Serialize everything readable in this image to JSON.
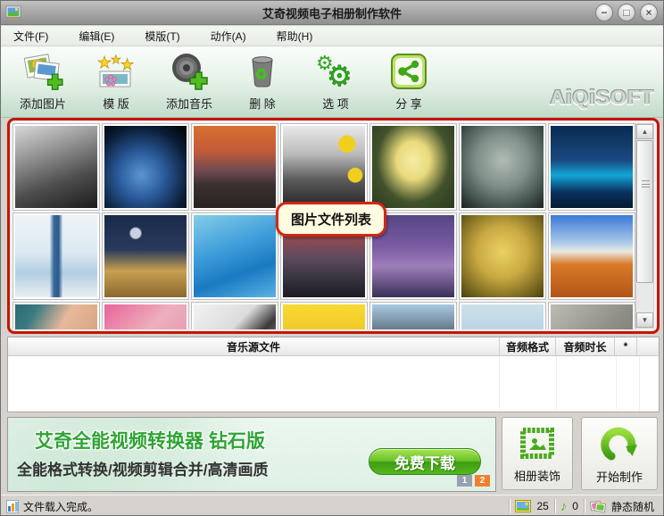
{
  "window": {
    "title": "艾奇视频电子相册制作软件",
    "controls": {
      "minimize": "−",
      "maximize": "□",
      "close": "×"
    }
  },
  "menu": {
    "items": [
      {
        "label": "文件(F)"
      },
      {
        "label": "编辑(E)"
      },
      {
        "label": "模版(T)"
      },
      {
        "label": "动作(A)"
      },
      {
        "label": "帮助(H)"
      }
    ]
  },
  "toolbar": {
    "buttons": [
      {
        "id": "add-images",
        "label": "添加图片"
      },
      {
        "id": "template",
        "label": "模 版"
      },
      {
        "id": "add-music",
        "label": "添加音乐"
      },
      {
        "id": "delete",
        "label": "删 除"
      },
      {
        "id": "options",
        "label": "选 项"
      },
      {
        "id": "share",
        "label": "分 享"
      }
    ],
    "logo": "AiQiSOFT"
  },
  "image_list": {
    "tooltip": "图片文件列表",
    "thumbnails": [
      {
        "name": "eiffel-tower-bw",
        "bg": "linear-gradient(160deg,#d8d8d8 0%,#9a9a9a 30%,#4e4e4e 65%,#1c1c1c 100%)"
      },
      {
        "name": "earth-from-space",
        "bg": "radial-gradient(circle at 45% 60%, #5a96d2 0%, #2a5a9a 35%, #0a1c34 72%, #000 100%)"
      },
      {
        "name": "stonehenge-sunset",
        "bg": "linear-gradient(180deg,#d96f2e 0%,#c05a3a 32%,#6e4a50 55%,#3a3030 72%,#282320 100%)"
      },
      {
        "name": "zen-stones-flowers",
        "bg": "radial-gradient(circle at 78% 22%, #f2cf1f 9%, rgba(0,0,0,0) 10%), radial-gradient(circle at 88% 60%, #f2cf1f 8%, rgba(0,0,0,0) 9%), linear-gradient(180deg,#e9e9e9 0%,#b9b9b9 35%,#5c5c5c 65%,#232323 100%)"
      },
      {
        "name": "duckling",
        "bg": "radial-gradient(ellipse at 50% 42%, #f6eda6 0%, #e9da7c 28%, #42522c 62%, #2a3a20 100%)"
      },
      {
        "name": "ferris-wheel",
        "bg": "radial-gradient(circle at 50% 42%, #b2bcb6 0%, #7e8e88 42%, #3c4c46 78%, #20201e 100%)"
      },
      {
        "name": "harbour-bridge-night",
        "bg": "linear-gradient(180deg,#0a2a50 0%,#1a4a82 42%,#12a6d6 60%,#0a3462 80%,#041a30 100%)"
      },
      {
        "name": "eiffel-tower-blue-art",
        "bg": "linear-gradient(90deg, rgba(0,0,0,0) 42%, #3a6a9a 47%, #2a5a8c 53%, rgba(0,0,0,0) 58%), linear-gradient(180deg,#eef3f7 0%,#dcEAf2 45%,#b2cee2 70%,#e9eef2 100%)"
      },
      {
        "name": "colosseum-night",
        "bg": "radial-gradient(circle at 38% 22%, #c8d2e2 6%, rgba(0,0,0,0) 8%), linear-gradient(180deg,#1a2a4a 0%,#2a3a5c 42%,#c8a050 68%,#8a6830 100%)"
      },
      {
        "name": "water-splash-wave",
        "bg": "linear-gradient(160deg,#84cdea 0%,#3f9eda 40%,#1a7ac2 68%,#5ab2e2 100%)"
      },
      {
        "name": "chambord-castle-sunset",
        "bg": "linear-gradient(180deg,#c85e30 0%,#8e4a50 30%,#5c4a60 52%,#3a3540 75%,#1e1c26 100%)"
      },
      {
        "name": "tower-bridge-purple",
        "bg": "linear-gradient(180deg,#564686 0%,#7a5aa2 38%,#9e7eba 62%,#3a3058 100%)"
      },
      {
        "name": "eiffel-tower-sepia",
        "bg": "radial-gradient(circle at 50% 45%, #ead263 0%, #caa942 42%, #7e6c22 76%, #4a4010 100%)"
      },
      {
        "name": "monument-valley",
        "bg": "linear-gradient(180deg,#3a7ad8 0%,#a8c8e8 33%,#e9e9e2 44%,#d87a28 60%,#b25618 100%)"
      },
      {
        "name": "face-closeup",
        "bg": "linear-gradient(120deg,#2e6a72 0%,#3a7a80 18%,#e8b89a 45%,#d8a888 72%,#2a2a2a 100%)"
      },
      {
        "name": "woman-in-pink",
        "bg": "linear-gradient(135deg,#e8659a 0%,#eeaebc 42%,#da8caa 100%)"
      },
      {
        "name": "girl-reading-paper",
        "bg": "linear-gradient(135deg,#f2f2f2 0%,#dcdcdc 38%,#3a3a3a 58%,#e9e9e9 100%)"
      },
      {
        "name": "yellow-tulips",
        "bg": "linear-gradient(180deg,#f8da32 0%,#ecba22 58%,#d8a818 100%)"
      },
      {
        "name": "king-penguins",
        "bg": "linear-gradient(180deg,#aac9e1 0%,#3c4c5a 48%,#e9e9e9 78%,#f0c838 100%)"
      },
      {
        "name": "beach-sky",
        "bg": "linear-gradient(180deg,#cde0ea 0%,#accade 58%,#8c9caa 100%)"
      },
      {
        "name": "koala",
        "bg": "linear-gradient(135deg,#bcbcb4 0%,#8e8e86 50%,#6a6a62 100%)"
      }
    ]
  },
  "music_table": {
    "headers": [
      "音乐源文件",
      "音频格式",
      "音频时长",
      "*"
    ],
    "rows": []
  },
  "banner": {
    "title": "艾奇全能视频转换器 钻石版",
    "subtitle": "全能格式转换/视频剪辑合并/高清画质",
    "download_label": "免费下载",
    "pages": [
      "1",
      "2"
    ]
  },
  "actions": {
    "decorate_label": "相册装饰",
    "start_label": "开始制作"
  },
  "status_bar": {
    "message": "文件载入完成。",
    "image_count": "25",
    "music_count": "0",
    "mode_label": "静态随机"
  },
  "colors": {
    "highlight_red": "#c41504",
    "accent_green": "#55b81e",
    "pager_orange": "#f08030"
  }
}
